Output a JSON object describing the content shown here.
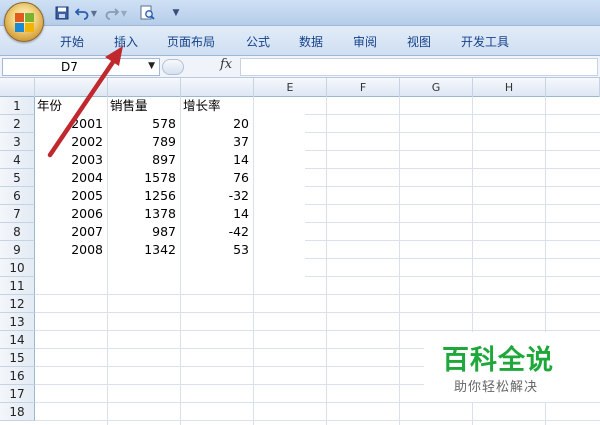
{
  "ribbon": {
    "tabs": [
      "开始",
      "插入",
      "页面布局",
      "公式",
      "数据",
      "审阅",
      "视图",
      "开发工具"
    ]
  },
  "formula_bar": {
    "name_box": "D7",
    "fx_label": "fx",
    "formula": ""
  },
  "grid": {
    "column_headers": [
      "",
      "",
      "",
      "E",
      "F",
      "G",
      "H"
    ],
    "row_headers": [
      "1",
      "2",
      "3",
      "4",
      "5",
      "6",
      "7",
      "8",
      "9",
      "10",
      "11",
      "12",
      "13",
      "14",
      "15",
      "16",
      "17",
      "18"
    ],
    "table_headers": [
      "年份",
      "销售量",
      "增长率"
    ],
    "rows": [
      [
        "2001",
        "578",
        "20"
      ],
      [
        "2002",
        "789",
        "37"
      ],
      [
        "2003",
        "897",
        "14"
      ],
      [
        "2004",
        "1578",
        "76"
      ],
      [
        "2005",
        "1256",
        "-32"
      ],
      [
        "2006",
        "1378",
        "14"
      ],
      [
        "2007",
        "987",
        "-42"
      ],
      [
        "2008",
        "1342",
        "53"
      ]
    ]
  },
  "annotation": {
    "arrow_color": "#c0282e",
    "points_to": "tab-insert"
  },
  "watermark": {
    "title": "百科全说",
    "subtitle": "助你轻松解决",
    "title_color": "#1fa83a"
  },
  "colors": {
    "ribbon_text": "#15428b",
    "gridline": "#d8e1ec"
  }
}
